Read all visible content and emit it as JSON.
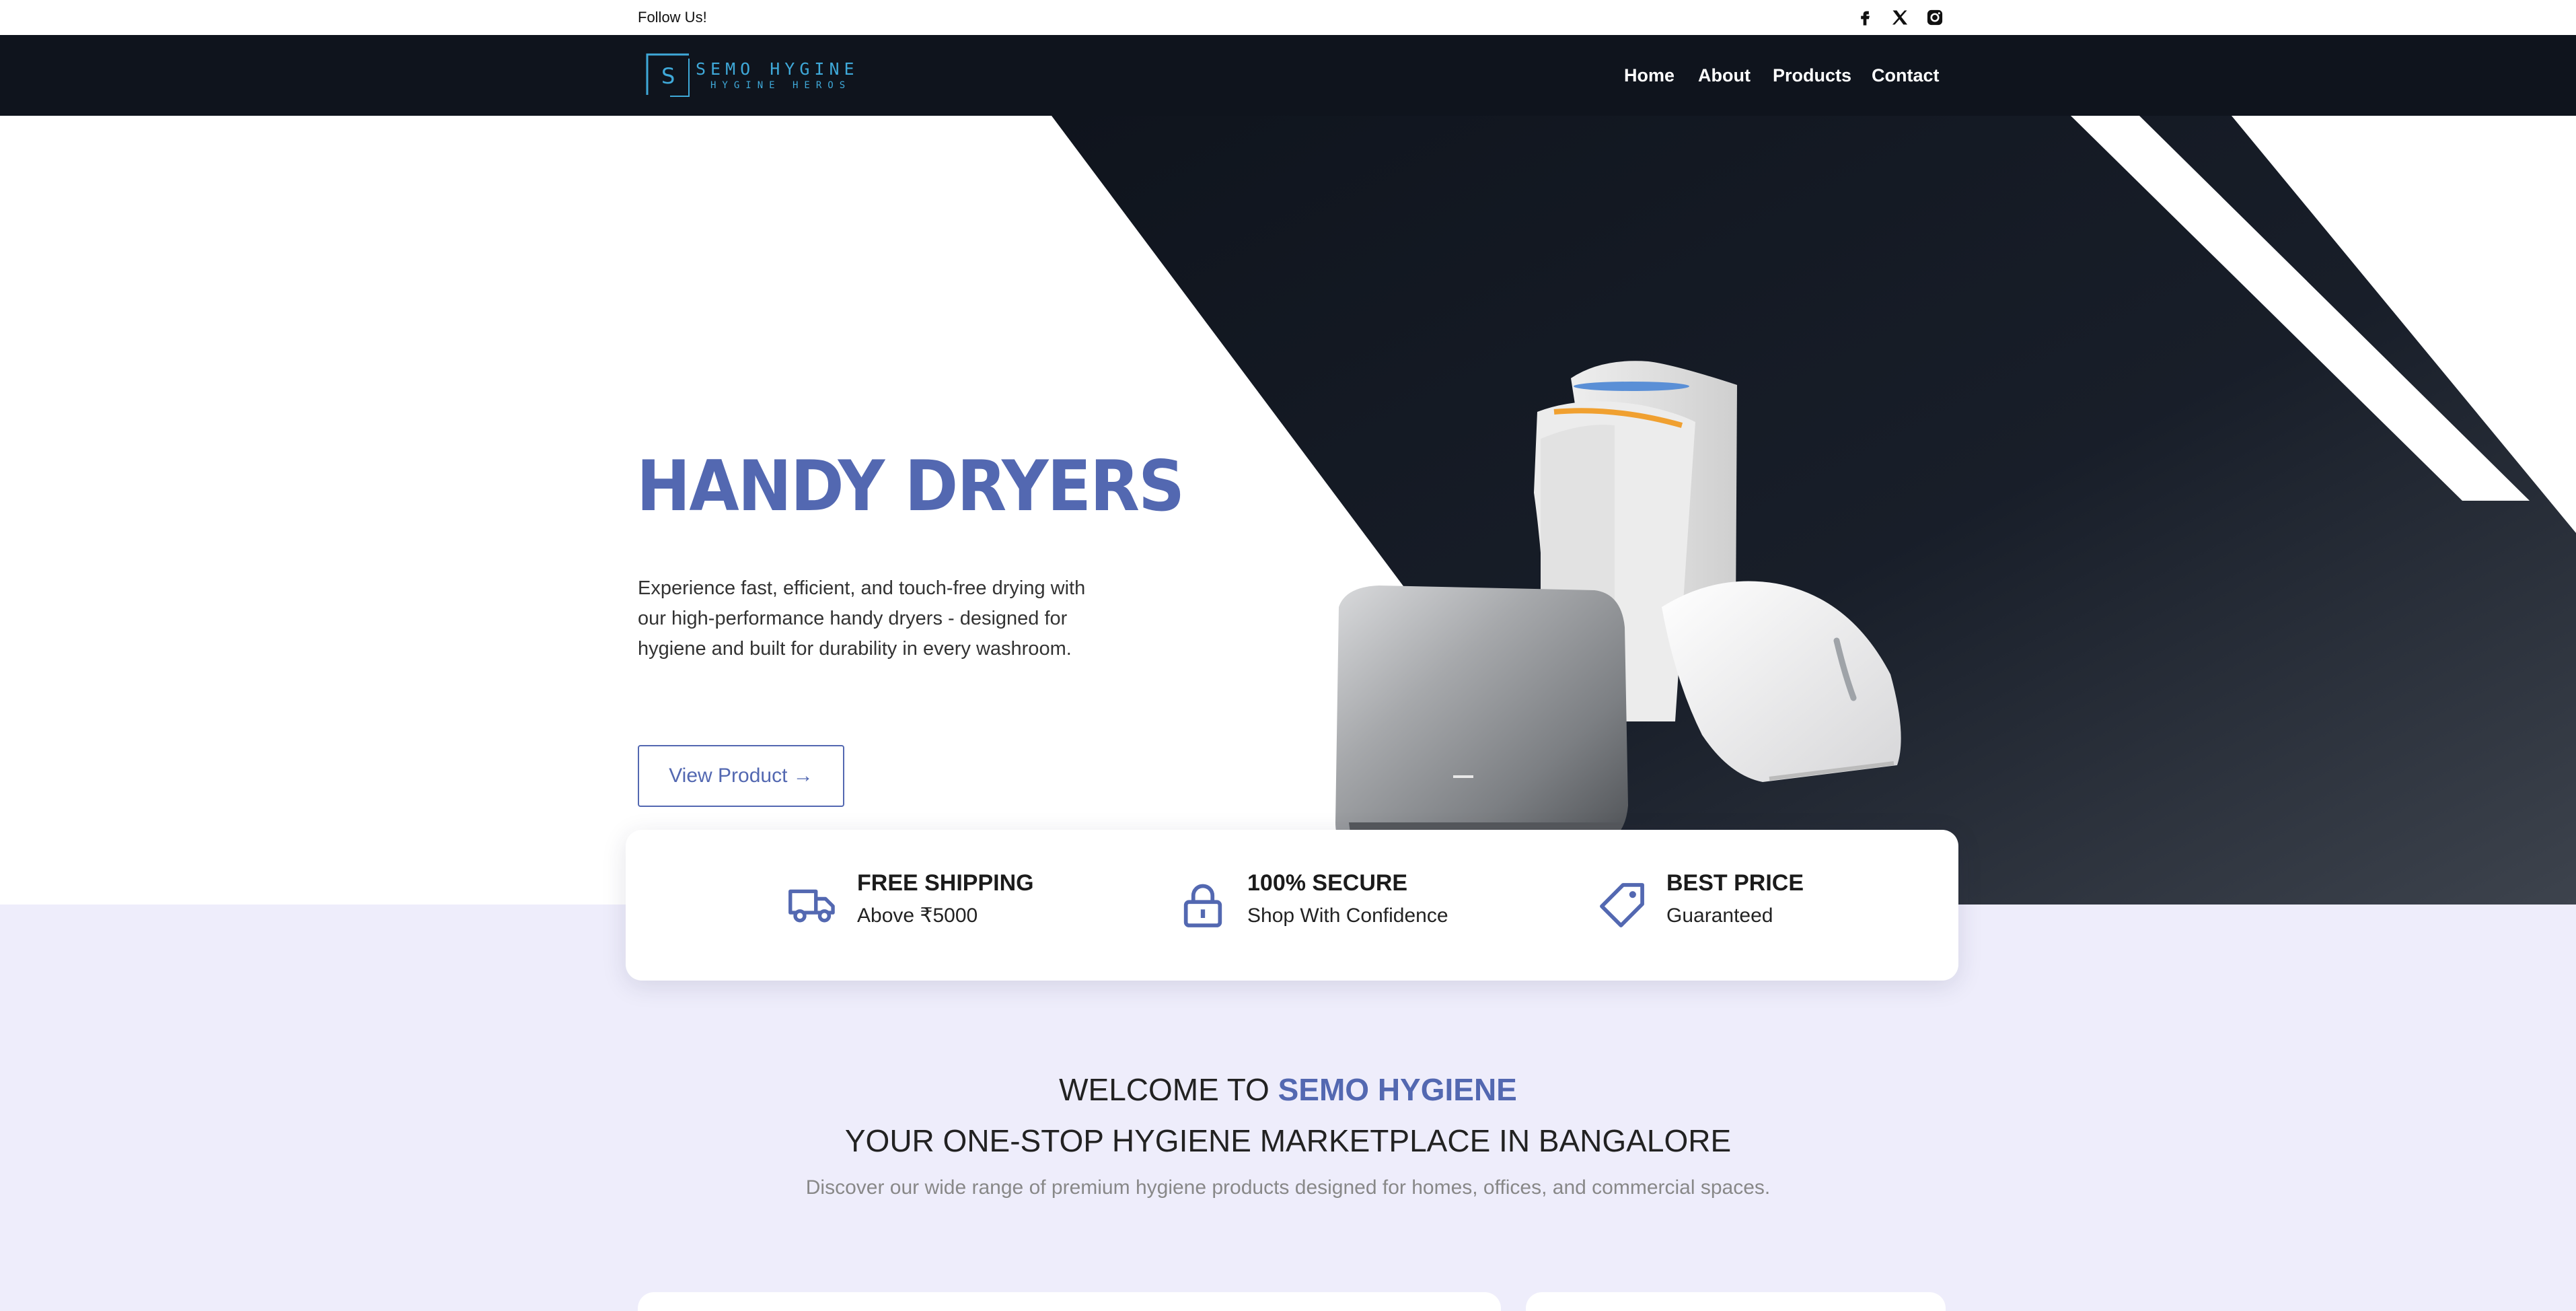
{
  "topbar": {
    "follow_label": "Follow Us!",
    "social_icons": [
      "facebook-icon",
      "x-icon",
      "instagram-icon"
    ]
  },
  "nav": {
    "logo_main": "SEMO HYGINE",
    "logo_sub": "HYGINE HEROS",
    "logo_letter": "S",
    "links": [
      "Home",
      "About",
      "Products",
      "Contact"
    ]
  },
  "hero": {
    "title": "HANDY DRYERS",
    "description": "Experience fast, efficient, and touch-free drying with our high-performance handy dryers - designed for hygiene and built for durability in every washroom.",
    "button_label": "View Product →"
  },
  "features": [
    {
      "icon": "truck-icon",
      "title": "FREE SHIPPING",
      "subtitle": "Above ₹5000"
    },
    {
      "icon": "lock-icon",
      "title": "100% SECURE",
      "subtitle": "Shop With Confidence"
    },
    {
      "icon": "price-tag-icon",
      "title": "BEST PRICE",
      "subtitle": "Guaranteed"
    }
  ],
  "welcome": {
    "prefix": "WELCOME TO ",
    "brand": "SEMO HYGIENE",
    "tagline": "YOUR ONE-STOP HYGIENE MARKETPLACE IN BANGALORE",
    "description": "Discover our wide range of premium hygiene products designed for homes, offices, and commercial spaces."
  },
  "colors": {
    "accent": "#5368b1",
    "nav_bg": "#0f141d",
    "section_bg": "#eeedfb",
    "logo": "#3fa9d9"
  }
}
